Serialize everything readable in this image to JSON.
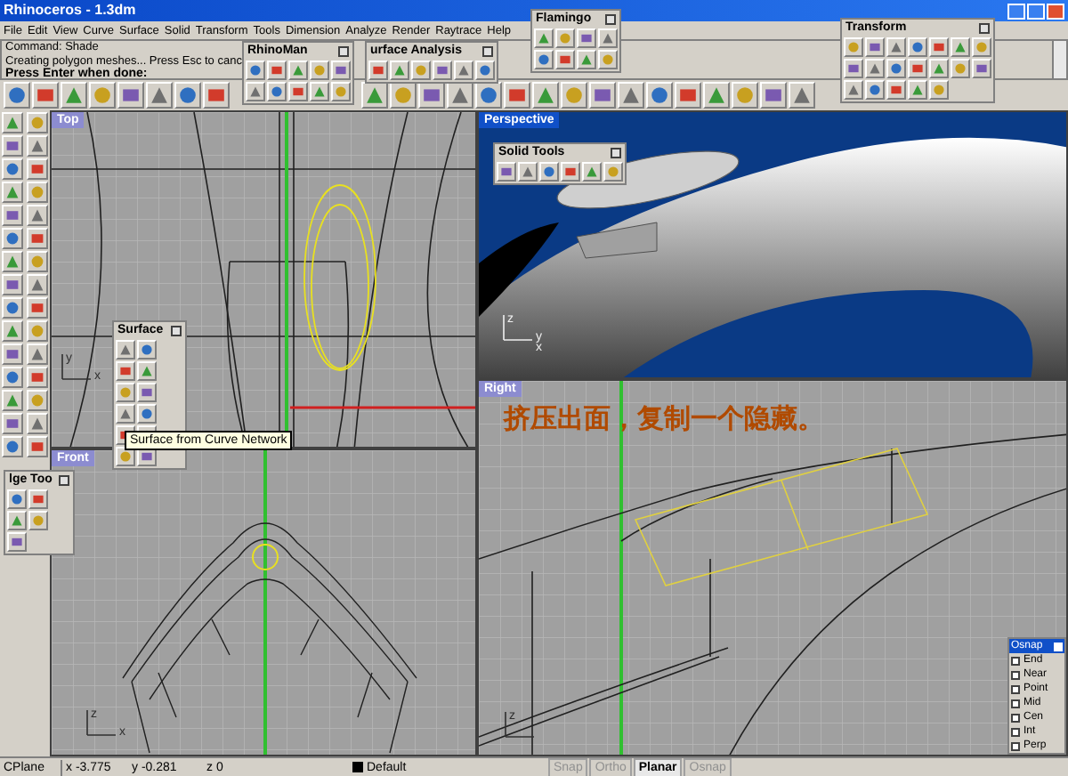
{
  "window": {
    "title": "Rhinoceros - 1.3dm"
  },
  "menu": [
    "File",
    "Edit",
    "View",
    "Curve",
    "Surface",
    "Solid",
    "Transform",
    "Tools",
    "Dimension",
    "Analyze",
    "Render",
    "Raytrace",
    "Help"
  ],
  "command": {
    "lines": [
      "Command: Shade",
      "Creating polygon meshes... Press Esc to canc"
    ],
    "prompt": "Press Enter when done:"
  },
  "viewports": [
    {
      "name": "Top",
      "selected": false,
      "kind": "wireframe",
      "axis_labels": [
        "y",
        "x"
      ]
    },
    {
      "name": "Perspective",
      "selected": true,
      "kind": "shaded",
      "axis_labels": [
        "z",
        "y",
        "x"
      ]
    },
    {
      "name": "Right",
      "selected": false,
      "kind": "wireframe",
      "axis_labels": [
        "z"
      ],
      "annotation": "挤压出面，复制一个隐藏。"
    },
    {
      "name": "Front",
      "selected": false,
      "kind": "wireframe",
      "axis_labels": [
        "z",
        "x"
      ]
    }
  ],
  "toolbars": [
    {
      "title": "RhinoMan"
    },
    {
      "title": "urface Analysis"
    },
    {
      "title": "Flamingo"
    },
    {
      "title": "Transform"
    },
    {
      "title": "Solid Tools"
    },
    {
      "title": "Surface",
      "tooltip": "Surface from Curve Network"
    },
    {
      "title": "lge Too"
    }
  ],
  "osnap": {
    "title": "Osnap",
    "options": [
      {
        "label": "End",
        "checked": false
      },
      {
        "label": "Near",
        "checked": false
      },
      {
        "label": "Point",
        "checked": false
      },
      {
        "label": "Mid",
        "checked": false
      },
      {
        "label": "Cen",
        "checked": false
      },
      {
        "label": "Int",
        "checked": false
      },
      {
        "label": "Perp",
        "checked": false
      }
    ]
  },
  "status_bar": {
    "plane": "CPlane",
    "x": "x -3.775",
    "y": "y -0.281",
    "z": "z 0",
    "layer": "Default",
    "toggles": [
      {
        "label": "Snap",
        "on": false
      },
      {
        "label": "Ortho",
        "on": false
      },
      {
        "label": "Planar",
        "on": true
      },
      {
        "label": "Osnap",
        "on": false
      }
    ]
  }
}
